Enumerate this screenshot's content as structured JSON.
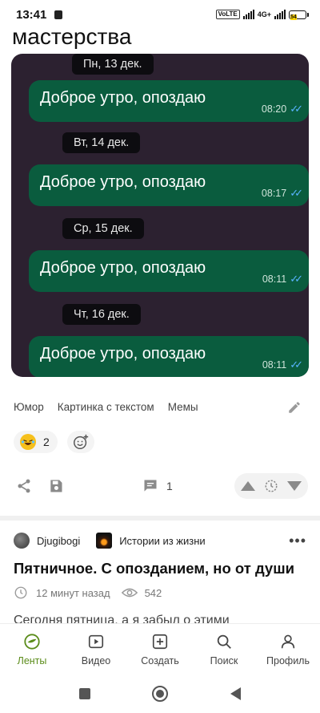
{
  "status_bar": {
    "time": "13:41",
    "network_tag": "VoLTE",
    "network_type": "4G+",
    "battery": "54"
  },
  "post_top": {
    "title_partial": "мастерства"
  },
  "chat_screenshot": {
    "dates": [
      "Пн, 13 дек.",
      "Вт, 14 дек.",
      "Ср, 15 дек.",
      "Чт, 16 дек."
    ],
    "messages": [
      {
        "text": "Доброе утро, опоздаю",
        "time": "08:20"
      },
      {
        "text": "Доброе утро, опоздаю",
        "time": "08:17"
      },
      {
        "text": "Доброе утро, опоздаю",
        "time": "08:11"
      },
      {
        "text": "Доброе утро, опоздаю",
        "time": "08:11"
      }
    ]
  },
  "tags": [
    "Юмор",
    "Картинка с текстом",
    "Мемы"
  ],
  "reactions": {
    "count": "2",
    "emoji_icon": "laughing-emoji-icon"
  },
  "actions": {
    "comments_count": "1"
  },
  "next_post": {
    "author": "Djugibogi",
    "community": "Истории из жизни",
    "title": "Пятничное. С опозданием, но от души",
    "time_ago": "12 минут назад",
    "views": "542",
    "snippet": "Сегодня пятница, а я забыл о этими"
  },
  "tabbar": {
    "items": [
      {
        "label": "Ленты",
        "icon": "feed-icon",
        "active": true
      },
      {
        "label": "Видео",
        "icon": "video-icon",
        "active": false
      },
      {
        "label": "Создать",
        "icon": "create-icon",
        "active": false
      },
      {
        "label": "Поиск",
        "icon": "search-icon",
        "active": false
      },
      {
        "label": "Профиль",
        "icon": "profile-icon",
        "active": false
      }
    ]
  },
  "colors": {
    "accent": "#5b8c1a",
    "chat_bg": "#2c2130",
    "bubble": "#0a5c3e",
    "read_ticks": "#59b4ff"
  }
}
